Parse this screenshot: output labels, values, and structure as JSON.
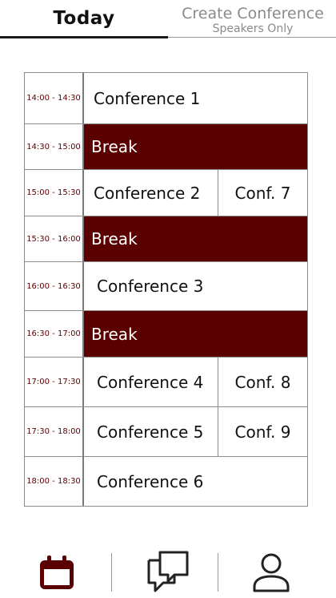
{
  "tabs": {
    "today": "Today",
    "create_title": "Create Conference",
    "create_subtitle": "Speakers Only"
  },
  "schedule": [
    {
      "time": "14:00 - 14:30",
      "main": "Conference 1"
    },
    {
      "time": "14:30 - 15:00",
      "main": "Break",
      "break": true
    },
    {
      "time": "15:00 - 15:30",
      "main": "Conference 2",
      "side": "Conf. 7"
    },
    {
      "time": "15:30 - 16:00",
      "main": "Break",
      "break": true
    },
    {
      "time": "16:00 - 16:30",
      "main": "Conference 3"
    },
    {
      "time": "16:30 - 17:00",
      "main": "Break",
      "break": true
    },
    {
      "time": "17:00 - 17:30",
      "main": "Conference 4",
      "side": "Conf. 8"
    },
    {
      "time": "17:30 - 18:00",
      "main": "Conference 5",
      "side": "Conf. 9"
    },
    {
      "time": "18:00 - 18:30",
      "main": "Conference 6"
    }
  ],
  "nav": {
    "calendar_icon": "calendar-icon",
    "chat_icon": "chat-bubbles-icon",
    "profile_icon": "user-icon"
  },
  "colors": {
    "accent": "#5b0000",
    "break_text": "#ffffff",
    "time_text": "#5a0000"
  }
}
